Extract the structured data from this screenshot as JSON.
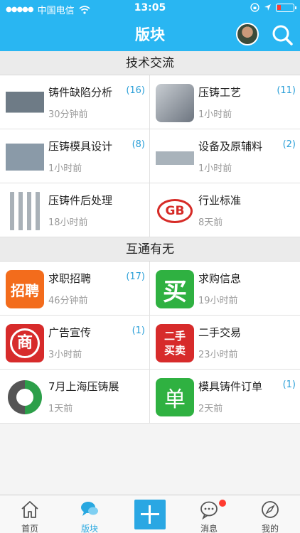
{
  "status": {
    "carrier": "中国电信",
    "time": "13:05"
  },
  "header": {
    "title": "版块"
  },
  "sections": [
    {
      "title": "技术交流",
      "items": [
        {
          "name": "铸件缺陷分析",
          "count": "(16)",
          "time": "30分钟前",
          "icon": "casting-defect-thumbnail"
        },
        {
          "name": "压铸工艺",
          "count": "(11)",
          "time": "1小时前",
          "icon": "die-casting-process-thumbnail"
        },
        {
          "name": "压铸模具设计",
          "count": "(8)",
          "time": "1小时前",
          "icon": "mold-design-thumbnail"
        },
        {
          "name": "设备及原辅料",
          "count": "(2)",
          "time": "1小时前",
          "icon": "equipment-thumbnail"
        },
        {
          "name": "压铸件后处理",
          "count": "",
          "time": "18小时前",
          "icon": "post-processing-thumbnail"
        },
        {
          "name": "行业标准",
          "count": "",
          "time": "8天前",
          "icon": "gb-standard-logo"
        }
      ]
    },
    {
      "title": "互通有无",
      "items": [
        {
          "name": "求职招聘",
          "count": "(17)",
          "time": "46分钟前",
          "icon": "recruit-icon",
          "glyph": "招聘"
        },
        {
          "name": "求购信息",
          "count": "",
          "time": "19小时前",
          "icon": "buy-icon",
          "glyph": "买"
        },
        {
          "name": "广告宣传",
          "count": "(1)",
          "time": "3小时前",
          "icon": "ad-icon",
          "glyph": "商"
        },
        {
          "name": "二手交易",
          "count": "",
          "time": "23小时前",
          "icon": "second-hand-icon",
          "glyph": "二手买卖"
        },
        {
          "name": "7月上海压铸展",
          "count": "",
          "time": "1天前",
          "icon": "expo-logo"
        },
        {
          "name": "模具铸件订单",
          "count": "(1)",
          "time": "2天前",
          "icon": "order-icon",
          "glyph": "单"
        }
      ]
    }
  ],
  "tabs": [
    {
      "label": "首页"
    },
    {
      "label": "版块"
    },
    {
      "label": ""
    },
    {
      "label": "消息"
    },
    {
      "label": "我的"
    }
  ],
  "colors": {
    "accent": "#29b6f2",
    "count": "#2a9fd8",
    "time": "#9a9a9a",
    "badge": "#ff3b30"
  }
}
